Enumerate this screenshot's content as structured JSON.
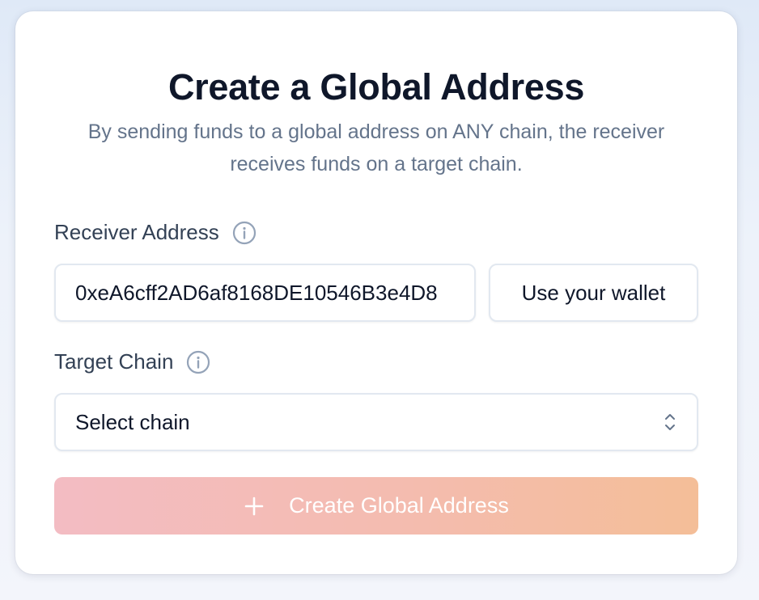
{
  "card": {
    "title": "Create a Global Address",
    "subtitle": "By sending funds to a global address on ANY chain, the receiver receives funds on a target chain."
  },
  "receiver": {
    "label": "Receiver Address",
    "value": "0xeA6cff2AD6af8168DE10546B3e4D8",
    "wallet_button": "Use your wallet"
  },
  "target_chain": {
    "label": "Target Chain",
    "selected": "Select chain"
  },
  "create_button": {
    "label": "Create Global Address",
    "state": "disabled"
  },
  "icons": {
    "info": "info-circle-icon",
    "chevrons": "chevron-up-down-icon",
    "plus": "plus-icon"
  },
  "colors": {
    "gradient_start": "#f3bcc3",
    "gradient_end": "#f4be98",
    "title": "#0f172a",
    "subtitle": "#64748b"
  }
}
